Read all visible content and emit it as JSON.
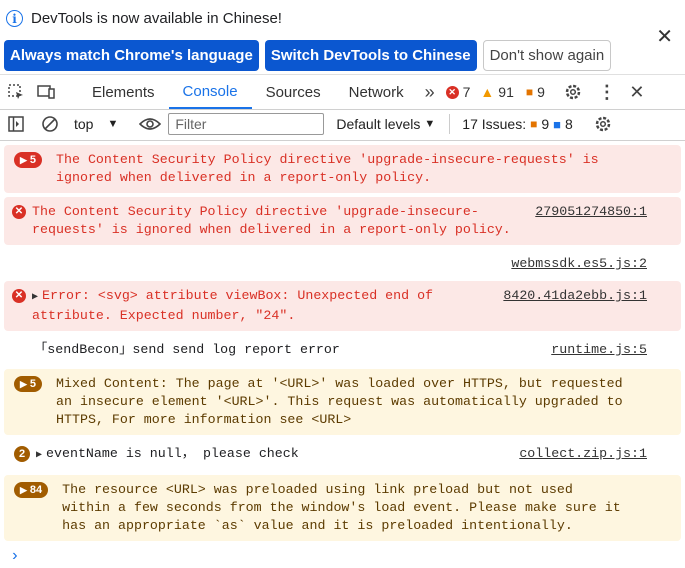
{
  "infobar": {
    "message": "DevTools is now available in Chinese!",
    "buttons": [
      "Always match Chrome's language",
      "Switch DevTools to Chinese",
      "Don't show again"
    ]
  },
  "tabs": [
    "Elements",
    "Console",
    "Sources",
    "Network"
  ],
  "counts": {
    "errors": "7",
    "warnings": "91",
    "issues": "9"
  },
  "toolbar": {
    "context": "top",
    "filter_placeholder": "Filter",
    "levels": "Default levels",
    "issues_label": "17 Issues:",
    "issues_warn": "9",
    "issues_info": "8"
  },
  "messages": [
    {
      "type": "error",
      "badge": "5",
      "text1": "The Content Security Policy directive 'upgrade-insecure-requests' is",
      "text2": "ignored when delivered in a report-only policy."
    },
    {
      "type": "error",
      "text1": "The Content Security Policy directive 'upgrade-insecure-",
      "text2": "requests' is ignored when delivered in a report-only policy.",
      "source": "279051274850:1"
    },
    {
      "type": "plain-src",
      "source": "webmssdk.es5.js:2"
    },
    {
      "type": "error",
      "text1": "Error: <svg> attribute viewBox: Unexpected end of",
      "text2": "attribute. Expected number, \"24\".",
      "source": "8420.41da2ebb.js:1"
    },
    {
      "type": "plain",
      "text1": "「sendBecon」send send log report error",
      "source": "runtime.js:5"
    },
    {
      "type": "warn",
      "badge": "5",
      "text1": "Mixed Content: The page at '<URL>' was loaded over HTTPS, but requested",
      "text2": "an insecure element '<URL>'. This request was automatically upgraded to",
      "text3": "HTTPS, For more information see <URL>"
    },
    {
      "type": "plain",
      "badge": "2",
      "text1": "eventName is null， please check",
      "source": "collect.zip.js:1"
    },
    {
      "type": "warn",
      "badge": "84",
      "text1": "The resource <URL> was preloaded using link preload but not used",
      "text2": "within a few seconds from the window's load event. Please make sure it",
      "text3": "has an appropriate `as` value and it is preloaded intentionally."
    }
  ]
}
